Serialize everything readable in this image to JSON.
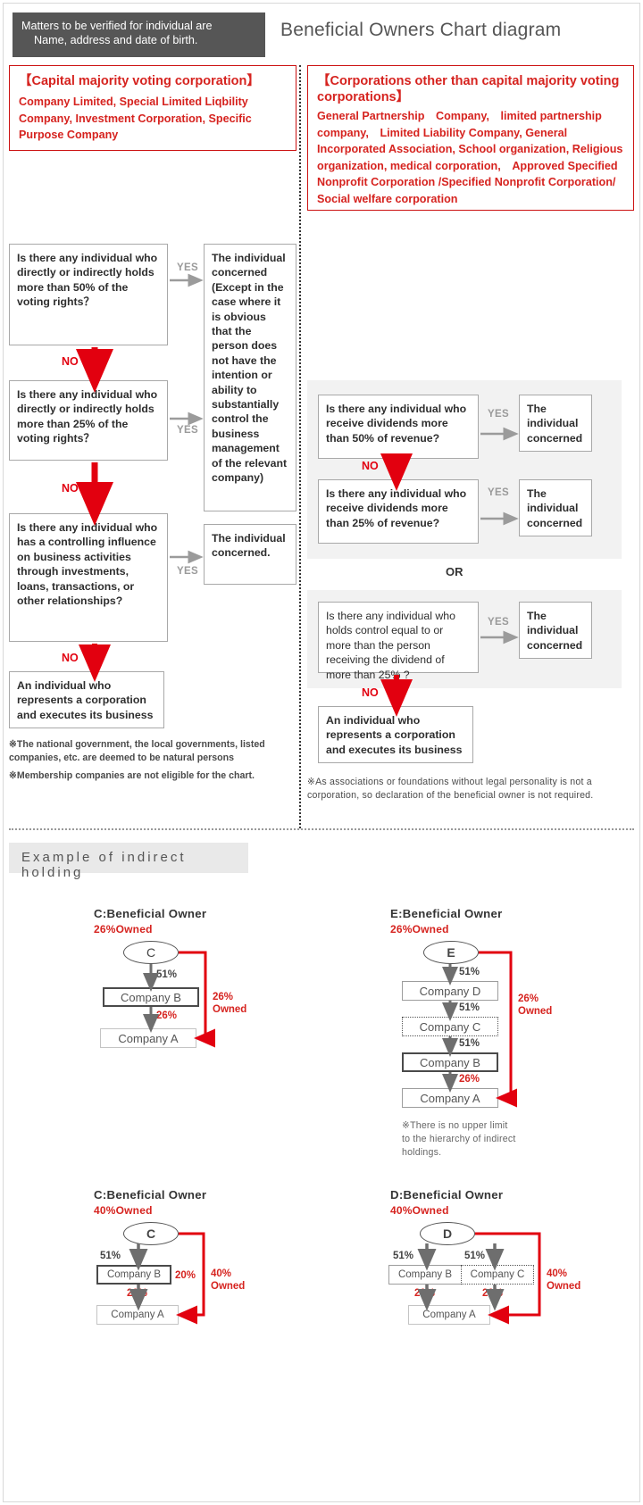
{
  "header": {
    "note_line1": "Matters to be verified for individual are",
    "note_line2": "Name, address and  date of birth.",
    "title": "Beneficial Owners Chart diagram"
  },
  "left_column": {
    "legend": {
      "title": "【Capital majority voting corporation】",
      "body": "Company Limited, Special Limited Liqbility Company, Investment Corporation, Specific Purpose Company"
    },
    "q1": "Is there any individual who directly or indirectly holds more than 50% of the voting rights？",
    "q2": "Is there any individual who directly or indirectly holds more than 25% of the voting rights？",
    "q3": "Is there any individual who has a controlling influence on business activities through investments, loans, transactions, or other relationships?",
    "result_long": "The individual concerned (Except in the case where it is obvious that the person does not have the intention or ability to substantially control the business management of the relevant company)",
    "result_short": "The individual concerned.",
    "final": "An individual who represents a corporation and executes its business",
    "yes_label": "YES",
    "no_label": "NO",
    "footnote1": "※The national government, the local governments, listed companies, etc. are deemed to be natural persons",
    "footnote2": "※Membership companies are not eligible for the chart."
  },
  "right_column": {
    "legend": {
      "title": "【Corporations other than capital majority voting corporations】",
      "body": "General Partnership　Company,　limited partnership company,　Limited Liability Company, General Incorporated Association, School organization, Religious　organization, medical corporation,　Approved Specified Nonprofit Corporation /Specified Nonprofit Corporation/ Social welfare corporation"
    },
    "q1": "Is there any individual who receive dividends more than 50% of revenue?",
    "q2": "Is there any individual who receive dividends more than 25% of revenue?",
    "q3": "Is there any individual who holds control equal to or  more than the person receiving the dividend of more than 25% ?",
    "result1": "The individual concerned",
    "result2": "The individual concerned",
    "result3": "The individual concerned",
    "final": "An individual who represents a corporation and executes its business",
    "yes_label": "YES",
    "no_label": "NO",
    "or_label": "OR",
    "footnote": "※As associations or foundations without legal personality is not a corporation, so declaration of the beneficial owner is not required."
  },
  "examples_section": {
    "title": "Example of indirect holding",
    "examples": [
      {
        "id": "ex1",
        "heading": "C:Beneficial Owner",
        "subheading": "26%Owned",
        "root": "C",
        "chain": [
          {
            "label": "Company B",
            "pct": "51%"
          },
          {
            "label": "Company A",
            "pct": "26%"
          }
        ],
        "owned_label_line1": "26%",
        "owned_label_line2": "Owned"
      },
      {
        "id": "ex2",
        "heading": "E:Beneficial Owner",
        "subheading": "26%Owned",
        "root": "E",
        "chain": [
          {
            "label": "Company D",
            "pct": "51%"
          },
          {
            "label": "Company C",
            "pct": "51%"
          },
          {
            "label": "Company B",
            "pct": "51%"
          },
          {
            "label": "Company A",
            "pct": "26%"
          }
        ],
        "owned_label_line1": "26%",
        "owned_label_line2": "Owned",
        "note": "※There is no upper limit to the hierarchy of indirect holdings."
      },
      {
        "id": "ex3",
        "heading": "C:Beneficial Owner",
        "subheading": "40%Owned",
        "root": "C",
        "left_pct": "51%",
        "mid_box": "Company B",
        "mid_pct": "20%",
        "bottom_box": "Company A",
        "right_pct": "20%",
        "owned_label_line1": "40%",
        "owned_label_line2": "Owned"
      },
      {
        "id": "ex4",
        "heading": "D:Beneficial Owner",
        "subheading": "40%Owned",
        "root": "D",
        "left_pct": "51%",
        "right_pct": "51%",
        "box_left": "Company B",
        "box_right": "Company C",
        "box_left_pct": "20%",
        "box_right_pct": "20%",
        "bottom_box": "Company A",
        "owned_label_line1": "40%",
        "owned_label_line2": "Owned"
      }
    ]
  },
  "chart_data": {
    "type": "diagram",
    "title": "Beneficial Owners Chart diagram",
    "flows": [
      {
        "name": "Capital majority voting corporation",
        "steps": [
          "50% voting rights",
          "25% voting rights",
          "controlling influence",
          "representative"
        ]
      },
      {
        "name": "Corporations other than capital majority voting corporations",
        "steps": [
          "50% of revenue dividends",
          "25% of revenue dividends",
          "control equal to or more than dividend receiver of 25%",
          "representative"
        ]
      }
    ],
    "holdings": [
      {
        "owner": "C",
        "path": [
          "C",
          "Company B",
          "Company A"
        ],
        "percents": [
          51,
          26
        ],
        "effective": 26
      },
      {
        "owner": "E",
        "path": [
          "E",
          "Company D",
          "Company C",
          "Company B",
          "Company A"
        ],
        "percents": [
          51,
          51,
          51,
          26
        ],
        "effective": 26
      },
      {
        "owner": "C",
        "path": [
          "C",
          "Company B",
          "Company A"
        ],
        "percents": [
          51,
          20
        ],
        "effective": 40,
        "direct": 20
      },
      {
        "owner": "D",
        "path": [
          "D",
          "Company B",
          "Company C",
          "Company A"
        ],
        "percents": [
          51,
          51,
          20,
          20
        ],
        "effective": 40
      }
    ]
  }
}
